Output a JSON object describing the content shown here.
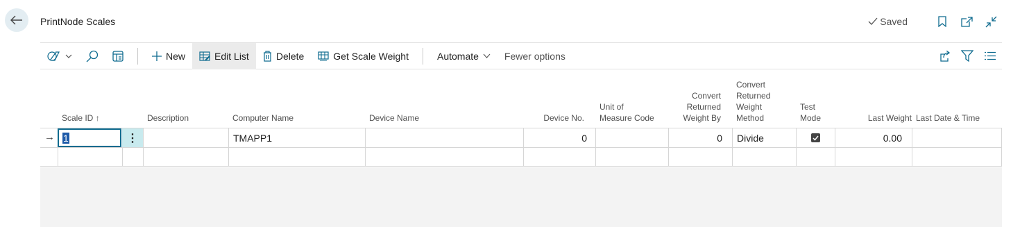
{
  "page": {
    "title": "PrintNode Scales",
    "saved_label": "Saved"
  },
  "toolbar": {
    "new_label": "New",
    "edit_list_label": "Edit List",
    "delete_label": "Delete",
    "get_scale_weight_label": "Get Scale Weight",
    "automate_label": "Automate",
    "fewer_options_label": "Fewer options"
  },
  "columns": {
    "scale_id": "Scale ID",
    "description": "Description",
    "computer_name": "Computer Name",
    "device_name": "Device Name",
    "device_no": "Device No.",
    "uom_line1": "Unit of",
    "uom_line2": "Measure Code",
    "crwb_line1": "Convert",
    "crwb_line2": "Returned",
    "crwb_line3": "Weight By",
    "crwm_line1": "Convert",
    "crwm_line2": "Returned",
    "crwm_line3": "Weight",
    "crwm_line4": "Method",
    "test_line1": "Test",
    "test_line2": "Mode",
    "last_weight": "Last Weight",
    "last_date_time": "Last Date & Time"
  },
  "rows": [
    {
      "scale_id": "1",
      "description": "",
      "computer_name": "TMAPP1",
      "device_name": "",
      "device_no": "0",
      "uom": "",
      "convert_by": "0",
      "convert_method": "Divide",
      "test_mode": true,
      "last_weight": "0.00",
      "last_date_time": ""
    }
  ],
  "sort_indicator": "↑",
  "row_arrow": "→",
  "icons": {
    "back": "back-arrow-icon",
    "bookmark": "bookmark-icon",
    "open_new": "open-in-new-window-icon",
    "collapse": "collapse-icon",
    "share": "share-icon",
    "filter": "filter-icon",
    "list": "list-icon"
  }
}
